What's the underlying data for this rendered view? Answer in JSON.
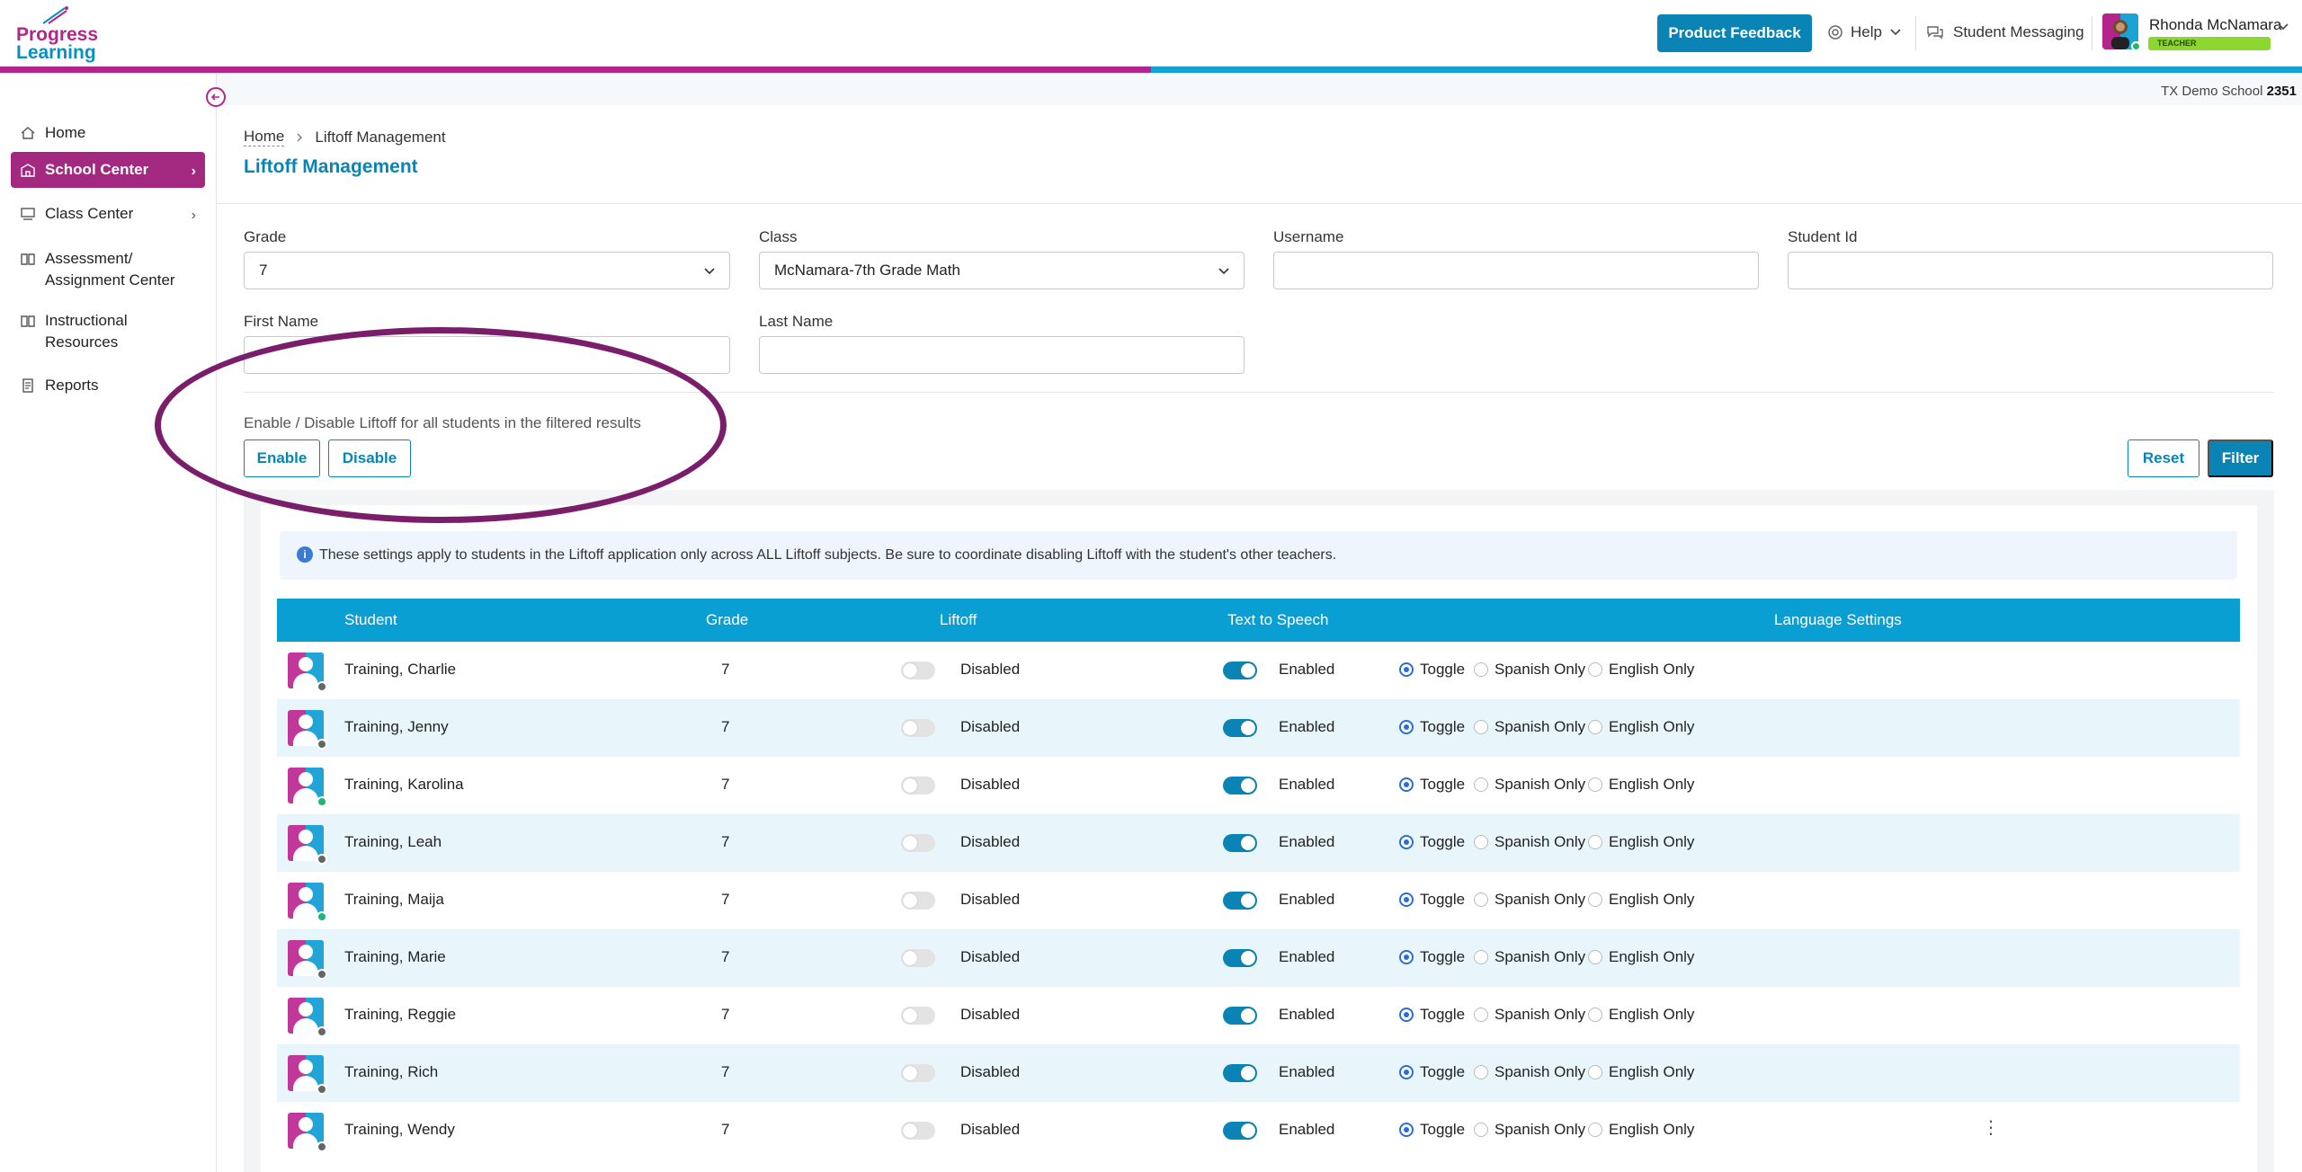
{
  "header": {
    "logo_line1": "Progress",
    "logo_line2": "Learning",
    "feedback_label": "Product Feedback",
    "help_label": "Help",
    "messaging_label": "Student Messaging",
    "user_name": "Rhonda McNamara",
    "user_role": "TEACHER"
  },
  "school": {
    "name": "TX Demo School",
    "number": "2351"
  },
  "sidebar": {
    "items": [
      {
        "label": "Home",
        "icon": "home-icon"
      },
      {
        "label": "School Center",
        "icon": "school-icon"
      },
      {
        "label": "Class Center",
        "icon": "class-icon"
      },
      {
        "label": "Assessment/ Assignment Center",
        "icon": "book-icon"
      },
      {
        "label": "Instructional Resources",
        "icon": "book-icon"
      },
      {
        "label": "Reports",
        "icon": "report-icon"
      }
    ]
  },
  "breadcrumb": {
    "home": "Home",
    "current": "Liftoff Management"
  },
  "page_title": "Liftoff Management",
  "filters": {
    "grade_label": "Grade",
    "grade_value": "7",
    "class_label": "Class",
    "class_value": "McNamara-7th Grade Math",
    "username_label": "Username",
    "username_value": "",
    "studentid_label": "Student Id",
    "studentid_value": "",
    "firstname_label": "First Name",
    "firstname_value": "",
    "lastname_label": "Last Name",
    "lastname_value": ""
  },
  "bulk": {
    "text": "Enable / Disable Liftoff for all students in the filtered results",
    "enable": "Enable",
    "disable": "Disable",
    "reset": "Reset",
    "filter": "Filter"
  },
  "info_text": "These settings apply to students in the Liftoff application only across ALL Liftoff subjects. Be sure to coordinate disabling Liftoff with the student's other teachers.",
  "table": {
    "headers": {
      "student": "Student",
      "grade": "Grade",
      "liftoff": "Liftoff",
      "tts": "Text to Speech",
      "language": "Language Settings"
    },
    "lang_options": [
      "Toggle",
      "Spanish Only",
      "English Only"
    ],
    "rows": [
      {
        "name": "Training, Charlie",
        "grade": "7",
        "liftoff": "Disabled",
        "tts": "Enabled",
        "online": false
      },
      {
        "name": "Training, Jenny",
        "grade": "7",
        "liftoff": "Disabled",
        "tts": "Enabled",
        "online": false
      },
      {
        "name": "Training, Karolina",
        "grade": "7",
        "liftoff": "Disabled",
        "tts": "Enabled",
        "online": true
      },
      {
        "name": "Training, Leah",
        "grade": "7",
        "liftoff": "Disabled",
        "tts": "Enabled",
        "online": false
      },
      {
        "name": "Training, Maija",
        "grade": "7",
        "liftoff": "Disabled",
        "tts": "Enabled",
        "online": true
      },
      {
        "name": "Training, Marie",
        "grade": "7",
        "liftoff": "Disabled",
        "tts": "Enabled",
        "online": false
      },
      {
        "name": "Training, Reggie",
        "grade": "7",
        "liftoff": "Disabled",
        "tts": "Enabled",
        "online": false
      },
      {
        "name": "Training, Rich",
        "grade": "7",
        "liftoff": "Disabled",
        "tts": "Enabled",
        "online": false
      },
      {
        "name": "Training, Wendy",
        "grade": "7",
        "liftoff": "Disabled",
        "tts": "Enabled",
        "online": false
      }
    ]
  },
  "colors": {
    "brand_magenta": "#b4248a",
    "brand_blue": "#0a84b4",
    "header_blue": "#0a9fd2"
  }
}
